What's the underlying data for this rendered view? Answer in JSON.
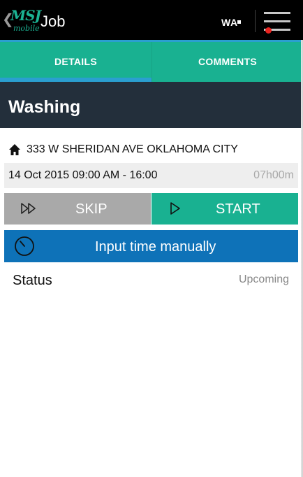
{
  "actionbar": {
    "logo_text": "MSJ",
    "logo_sub": "mobile",
    "title": "Job",
    "state_code": "WA",
    "back_icon": "chevron-left-icon",
    "menu_icon": "hamburger-menu-icon"
  },
  "tabs": [
    {
      "label": "DETAILS",
      "selected": true
    },
    {
      "label": "COMMENTS",
      "selected": false
    }
  ],
  "job": {
    "name": "Washing",
    "address": "333 W SHERIDAN AVE OKLAHOMA CITY",
    "schedule": "14 Oct 2015 09:00 AM - 16:00",
    "duration": "07h00m"
  },
  "actions": {
    "skip_label": "SKIP",
    "start_label": "START",
    "manual_label": "Input time manually"
  },
  "status": {
    "label": "Status",
    "value": "Upcoming"
  },
  "colors": {
    "accent": "#19b191",
    "header": "#232f3b",
    "manual_button": "#0e72b8",
    "skip_button": "#a9a9a9",
    "tab_indicator": "#2a9fd0",
    "notification": "#e8231f"
  }
}
